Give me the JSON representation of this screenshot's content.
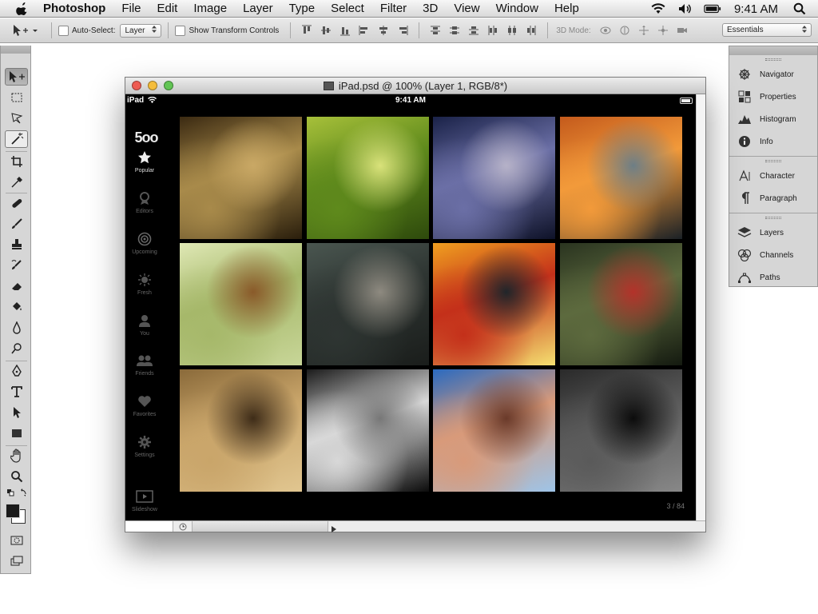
{
  "menubar": {
    "app_name": "Photoshop",
    "items": [
      "File",
      "Edit",
      "Image",
      "Layer",
      "Type",
      "Select",
      "Filter",
      "3D",
      "View",
      "Window",
      "Help"
    ],
    "clock": "9:41 AM"
  },
  "options": {
    "auto_select_label": "Auto-Select:",
    "auto_select_value": "Layer",
    "show_transform_label": "Show Transform Controls",
    "mode_3d_label": "3D Mode:",
    "workspace_value": "Essentials"
  },
  "document": {
    "title": "iPad.psd @ 100% (Layer 1, RGB/8*)"
  },
  "ipad": {
    "carrier": "iPad",
    "time": "9:41 AM",
    "logo": "5oo",
    "nav": [
      {
        "label": "Popular",
        "icon": "star-icon"
      },
      {
        "label": "Editors",
        "icon": "editors-icon"
      },
      {
        "label": "Upcoming",
        "icon": "upcoming-icon"
      },
      {
        "label": "Fresh",
        "icon": "fresh-icon"
      },
      {
        "label": "You",
        "icon": "user-icon"
      },
      {
        "label": "Friends",
        "icon": "friends-icon"
      },
      {
        "label": "Favorites",
        "icon": "heart-icon"
      },
      {
        "label": "Settings",
        "icon": "gear-icon"
      },
      {
        "label": "Slideshow",
        "icon": "slideshow-icon"
      }
    ],
    "counter": "3 / 84",
    "photos": [
      {
        "name": "forest-sunbeams-photo",
        "colors": [
          "#3b2a12",
          "#a88a4a",
          "#c9a865",
          "#2a1e0c"
        ]
      },
      {
        "name": "dragonfly-photo",
        "colors": [
          "#a7c03a",
          "#5f8a1c",
          "#d9e27a",
          "#2e4a0c"
        ]
      },
      {
        "name": "owl-photo",
        "colors": [
          "#1a2248",
          "#6b6fa6",
          "#b6b2c8",
          "#0e1228"
        ]
      },
      {
        "name": "lake-reflection-photo",
        "colors": [
          "#c45a1c",
          "#f29a3a",
          "#6d7e86",
          "#1b2126"
        ]
      },
      {
        "name": "flying-owl-photo",
        "colors": [
          "#dfe8b5",
          "#a6b86a",
          "#8a5a2a",
          "#c8d698"
        ]
      },
      {
        "name": "woman-red-dress-photo",
        "colors": [
          "#4a5650",
          "#2e3532",
          "#8e8a80",
          "#1a1d1b"
        ]
      },
      {
        "name": "rain-window-sunset-photo",
        "colors": [
          "#f0a020",
          "#c4301a",
          "#20262a",
          "#f5e070"
        ]
      },
      {
        "name": "ants-macro-photo",
        "colors": [
          "#2a3420",
          "#5d6a3e",
          "#b3322a",
          "#141a10"
        ]
      },
      {
        "name": "city-street-rain-photo",
        "colors": [
          "#8a6a3a",
          "#c9a56a",
          "#3e2c18",
          "#e1c690"
        ]
      },
      {
        "name": "woman-portrait-bw-photo",
        "colors": [
          "#1c1c1c",
          "#d8d8d8",
          "#777777",
          "#0c0c0c"
        ]
      },
      {
        "name": "woman-blue-butterflies-photo",
        "colors": [
          "#2a6ac0",
          "#d89a7a",
          "#6a3a2a",
          "#9ec4e8"
        ]
      },
      {
        "name": "gorilla-bw-photo",
        "colors": [
          "#2a2a2a",
          "#5a5a5a",
          "#0c0c0c",
          "#888888"
        ]
      }
    ]
  },
  "panels": {
    "group1": [
      "Navigator",
      "Properties",
      "Histogram",
      "Info"
    ],
    "group2": [
      "Character",
      "Paragraph"
    ],
    "group3": [
      "Layers",
      "Channels",
      "Paths"
    ]
  },
  "colors": {
    "traffic_red": "#ee5b52",
    "traffic_yellow": "#f5bd3a",
    "traffic_green": "#62c554",
    "toolbar_bg": "#d6d6d6",
    "menubar_bg": "#e5e5e5"
  }
}
